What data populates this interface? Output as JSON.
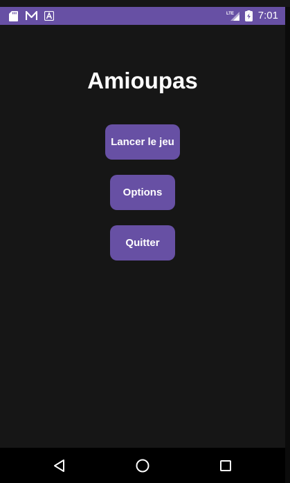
{
  "status_bar": {
    "time": "7:01",
    "icons": [
      "sd-card-icon",
      "n-notification-icon",
      "a-notification-icon",
      "lte-signal-icon",
      "battery-charging-icon"
    ],
    "color": "#6750a4"
  },
  "app": {
    "title": "Amioupas",
    "background": "#161616",
    "accent": "#6750a4",
    "buttons": {
      "start_label": "Lancer le jeu",
      "options_label": "Options",
      "quit_label": "Quitter"
    }
  },
  "nav_bar": {
    "icons": [
      "back-icon",
      "home-icon",
      "recents-icon"
    ]
  }
}
